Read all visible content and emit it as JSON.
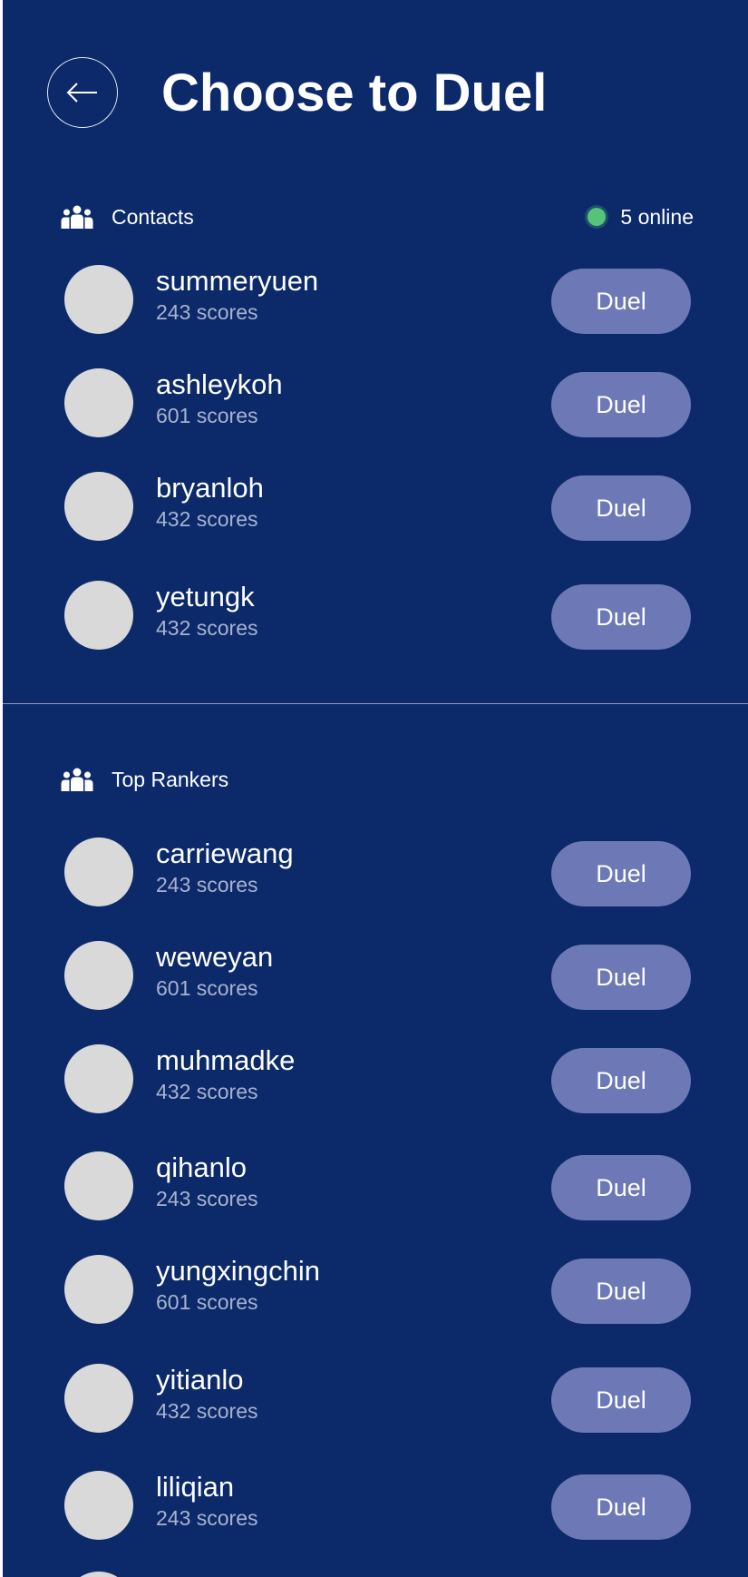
{
  "header": {
    "title": "Choose to Duel",
    "back_icon": "arrow-left-icon"
  },
  "contacts": {
    "label": "Contacts",
    "icon": "people-group-icon",
    "online_text": "5 online",
    "online_color": "#56c27a",
    "users": [
      {
        "name": "summeryuen",
        "scores": "243 scores",
        "action": "Duel"
      },
      {
        "name": "ashleykoh",
        "scores": "601 scores",
        "action": "Duel"
      },
      {
        "name": "bryanloh",
        "scores": "432 scores",
        "action": "Duel"
      },
      {
        "name": "yetungk",
        "scores": "432 scores",
        "action": "Duel"
      }
    ]
  },
  "top_rankers": {
    "label": "Top Rankers",
    "icon": "people-group-icon",
    "users": [
      {
        "name": "carriewang",
        "scores": "243 scores",
        "action": "Duel"
      },
      {
        "name": "weweyan",
        "scores": "601 scores",
        "action": "Duel"
      },
      {
        "name": "muhmadke",
        "scores": "432 scores",
        "action": "Duel"
      },
      {
        "name": "qihanlo",
        "scores": "243 scores",
        "action": "Duel"
      },
      {
        "name": "yungxingchin",
        "scores": "601 scores",
        "action": "Duel"
      },
      {
        "name": "yitianlo",
        "scores": "432 scores",
        "action": "Duel"
      },
      {
        "name": "liliqian",
        "scores": "243 scores",
        "action": "Duel"
      }
    ]
  },
  "colors": {
    "background": "#0c2a6a",
    "duel_button": "#6d79b6",
    "avatar_placeholder": "#d9d9d9",
    "score_text": "#a8b2cf"
  }
}
